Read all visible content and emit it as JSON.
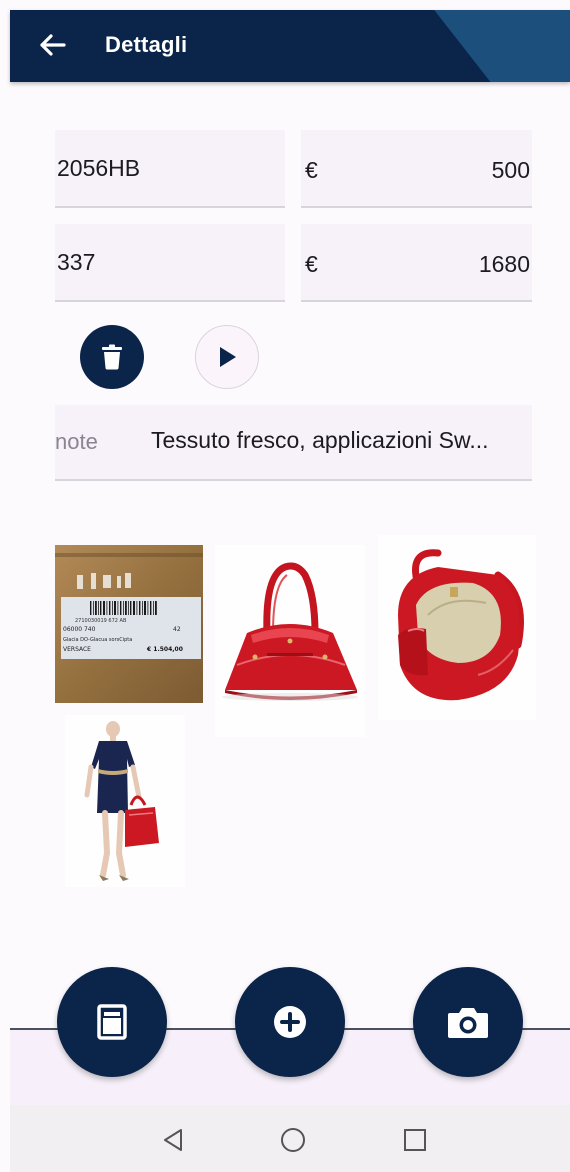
{
  "header": {
    "title": "Dettagli",
    "back_icon": "arrow-left-icon",
    "color": "#0b2449",
    "accent": "#1c4f7c"
  },
  "fields": {
    "code_1": "2056HB",
    "currency_1": "€",
    "price_1": "500",
    "code_2": "337",
    "currency_2": "€",
    "price_2": "1680"
  },
  "actions": {
    "delete_icon": "trash-icon",
    "play_icon": "play-icon"
  },
  "note": {
    "label": "note",
    "value": "Tessuto fresco, applicazioni Sw..."
  },
  "photos": [
    {
      "description": "label-photo",
      "lines": [
        "2710030019 672  AB",
        "06000 740",
        "42",
        "Glacia DO-Glacua sorsCipta",
        "VERSACE",
        "€ 1.504,00"
      ]
    },
    {
      "description": "red-bag-front"
    },
    {
      "description": "red-bag-open"
    },
    {
      "description": "model-dress-red-bag"
    }
  ],
  "bottom_actions": {
    "left_icon": "document-icon",
    "center_icon": "add-circle-icon",
    "right_icon": "camera-icon"
  },
  "system_nav": [
    "back-triangle-icon",
    "home-circle-icon",
    "recents-square-icon"
  ]
}
